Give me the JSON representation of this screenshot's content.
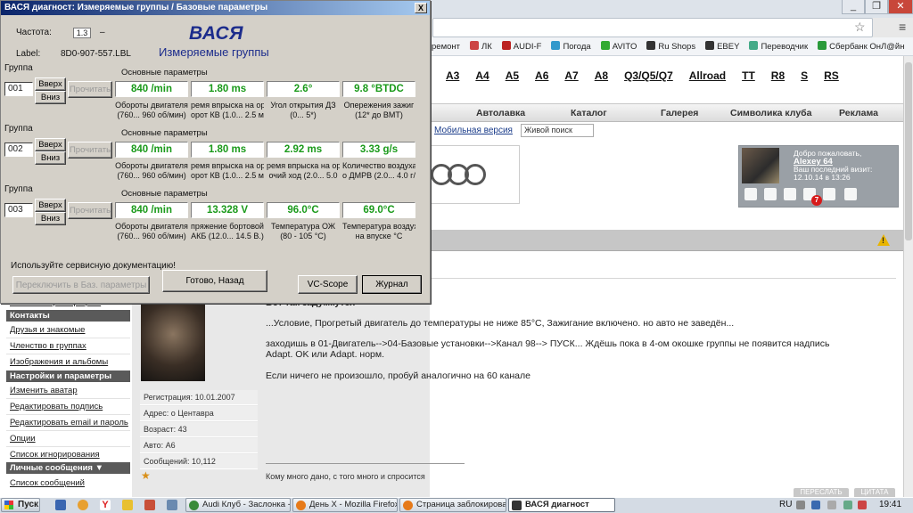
{
  "browser": {
    "bookmarks": [
      {
        "label": "ремонт",
        "icon": "page-icon",
        "color": "#c9c9c9"
      },
      {
        "label": "ЛК",
        "icon": "page-icon",
        "color": "#c44"
      },
      {
        "label": "AUDI-F",
        "icon": "audi-icon",
        "color": "#b22"
      },
      {
        "label": "Погода",
        "icon": "weather-icon",
        "color": "#39c"
      },
      {
        "label": "AVITO",
        "icon": "avito-icon",
        "color": "#3a3"
      },
      {
        "label": "Ru Shops",
        "icon": "cart-icon",
        "color": "#333"
      },
      {
        "label": "EBEY",
        "icon": "cart-icon",
        "color": "#333"
      },
      {
        "label": "Переводчик",
        "icon": "translate-icon",
        "color": "#4a8"
      },
      {
        "label": "Сбербанк ОнЛ@йн",
        "icon": "sberbank-icon",
        "color": "#2a9a3a"
      }
    ],
    "models": [
      "A3",
      "A4",
      "A5",
      "A6",
      "A7",
      "A8",
      "Q3/Q5/Q7",
      "Allroad",
      "TT",
      "R8",
      "S",
      "RS"
    ],
    "nav": [
      "Автолавка",
      "Каталог",
      "Галерея",
      "Символика клуба",
      "Реклама"
    ],
    "mobile_link": "Мобильная версия",
    "live_search_placeholder": "Живой поиск",
    "user": {
      "welcome": "Добро пожаловать,",
      "name": "Alexey 64",
      "last_visit_label": "Ваш последний визит:",
      "last_visit": "12.10.14 в 13:26",
      "notifications": "7"
    },
    "sidebar": {
      "truncated_link": "Изменить фотографию",
      "sections": [
        {
          "title": "Контакты",
          "links": [
            "Друзья и знакомые",
            "Членство в группах",
            "Изображения и альбомы"
          ]
        },
        {
          "title": "Настройки и параметры",
          "links": [
            "Изменить аватар",
            "Редактировать подпись",
            "Редактировать email и пароль",
            "Опции",
            "Список игнорирования"
          ]
        },
        {
          "title": "Личные сообщения ▼",
          "links": [
            "Список сообщений"
          ]
        }
      ]
    },
    "post": {
      "header_partial": "Вот так задумкутся",
      "lines": [
        "...Условие, Прогретый двигатель до температуры не ниже 85°С, Зажигание включено. но авто не заведён...",
        "заходишь в 01-Двигатель-->04-Базовые установки-->Канал 98--> ПУСК... Ждёшь пока в 4-ом окошке группы не появится надпись",
        "Adapt. OK или Adapt. норм.",
        "Если ничего не произошло, пробуй аналогично на 60 канале"
      ],
      "signature": "Кому много дано, с того много и спросится",
      "buttons": [
        "ПЕРЕСЛАТЬ",
        "ЦИТАТА"
      ]
    },
    "user_info": {
      "registration": "Регистрация: 10.01.2007",
      "address": "Адрес: о Центавра",
      "age": "Возраст: 43",
      "car": "Авто: A6",
      "messages": "Сообщений: 10,112"
    }
  },
  "dialog": {
    "title": "ВАСЯ диагност: Измеряемые группы / Базовые параметры",
    "close_label": "X",
    "freq_label": "Частота:",
    "freq_value": "1.3",
    "freq_dash": "–",
    "label_label": "Label:",
    "label_value": "8D0-907-557.LBL",
    "brand": "ВАСЯ",
    "subtitle": "Измеряемые группы",
    "group_label": "Группа",
    "up_label": "Вверх",
    "down_label": "Вниз",
    "read_label": "Прочитать",
    "groups": [
      {
        "number": "001",
        "title": "Основные параметры",
        "values": [
          "840 /min",
          "1.80 ms",
          "2.6°",
          "9.8 °BTDC"
        ],
        "desc1": [
          "Обороты двигателя",
          "ремя впрыска на ор",
          "Угол открытия ДЗ",
          "Опережения зажиг"
        ],
        "desc2": [
          "(760... 960 об/мин)",
          "орот КВ (1.0... 2.5 м",
          "(0... 5*)",
          "(12* до ВМТ)"
        ]
      },
      {
        "number": "002",
        "title": "Основные параметры",
        "values": [
          "840 /min",
          "1.80 ms",
          "2.92 ms",
          "3.33 g/s"
        ],
        "desc1": [
          "Обороты двигателя",
          "ремя впрыска на ор",
          "ремя впрыска на ор",
          "Количество воздуха"
        ],
        "desc2": [
          "(760... 960 об/мин)",
          "орот КВ (1.0... 2.5 м",
          "очий ход (2.0... 5.0",
          "о ДМРВ (2.0... 4.0 г/"
        ]
      },
      {
        "number": "003",
        "title": "Основные параметры",
        "values": [
          "840 /min",
          "13.328 V",
          "96.0°C",
          "69.0°C"
        ],
        "desc1": [
          "Обороты двигателя",
          "пряжение бортовой",
          "Температура ОЖ",
          "Температура воздуха"
        ],
        "desc2": [
          "(760... 960 об/мин)",
          "АКБ (12.0... 14.5 В.)",
          "(80 - 105 °С)",
          "на впуске °С"
        ]
      }
    ],
    "service_text": "Используйте сервисную документацию!",
    "switch_btn": "Переключить в Баз. параметры",
    "back_btn": "Готово, Назад",
    "vcscope_btn": "VC-Scope",
    "journal_btn": "Журнал",
    "value_color": "#1a9a1a"
  },
  "taskbar": {
    "start": "Пуск",
    "tasks": [
      {
        "label": "Audi Клуб - Заслонка - ...",
        "icon": "chrome-icon",
        "color": "#3a8a3a"
      },
      {
        "label": "День Х - Mozilla Firefox",
        "icon": "firefox-icon",
        "color": "#e67a1a"
      },
      {
        "label": "Страница заблокирова...",
        "icon": "firefox-icon",
        "color": "#e67a1a"
      },
      {
        "label": "ВАСЯ диагност",
        "icon": "vasya-icon",
        "color": "#333333"
      }
    ],
    "lang": "RU",
    "time": "19:41"
  }
}
